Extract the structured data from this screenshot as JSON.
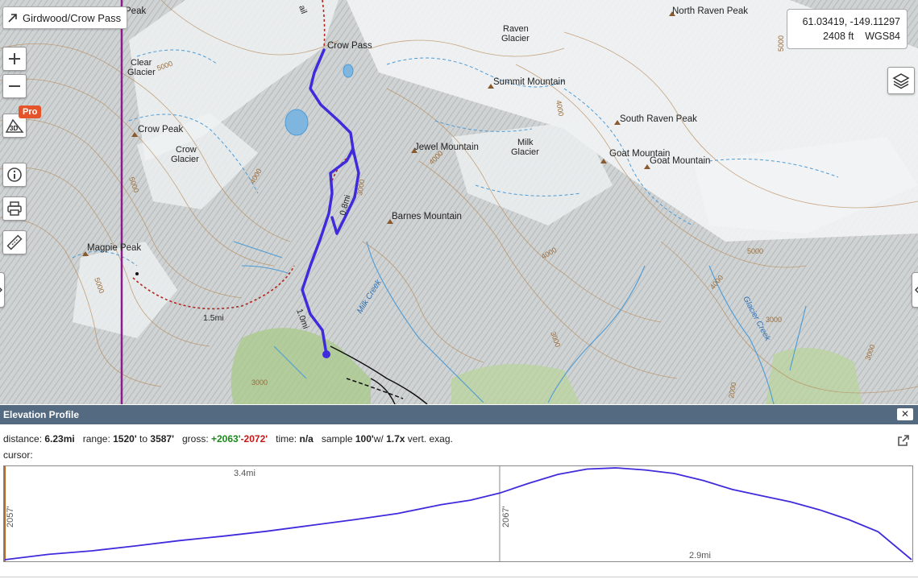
{
  "map": {
    "title": "Girdwood/Crow Pass",
    "coordinates": "61.03419, -149.11297",
    "elevation": "2408 ft",
    "datum": "WGS84",
    "pro_badge": "Pro",
    "btn_3d": "3D",
    "labels": {
      "peak_top": "Peak",
      "north_raven_peak": "North Raven Peak",
      "raven_glacier_1": "Raven",
      "raven_glacier_2": "Glacier",
      "crow_pass": "Crow Pass",
      "clear_glacier_1": "Clear",
      "clear_glacier_2": "Glacier",
      "summit_mountain": "Summit Mountain",
      "crow_peak": "Crow Peak",
      "crow_glacier_1": "Crow",
      "crow_glacier_2": "Glacier",
      "south_raven_peak": "South Raven Peak",
      "jewel_mountain": "Jewel Mountain",
      "milk_glacier_1": "Milk",
      "milk_glacier_2": "Glacier",
      "goat_mountain_1": "Goat Mountain",
      "goat_mountain_2": "Goat Mountain",
      "barnes_mountain": "Barnes Mountain",
      "magpie_peak": "Magpie Peak",
      "milk_creek": "Milk Creek",
      "glacier_creek": "Glacier Creek",
      "dist_1_5": "1.5mi",
      "dist_1_0": "1.0mi",
      "dist_0_8": "0.8mi",
      "trail_fragment": "ail"
    },
    "contours": [
      "5000",
      "5000",
      "4000",
      "3000",
      "5000",
      "4000",
      "4000",
      "5000",
      "4000",
      "3000",
      "4000",
      "3000",
      "2000",
      "3000",
      "3000",
      "5000"
    ],
    "colors": {
      "route": "#3f2bdc",
      "trail_red": "#b3261e",
      "boundary": "#8e1a8e",
      "water": "#4d9bd6"
    }
  },
  "elevation": {
    "header": "Elevation Profile",
    "close": "✕",
    "stats": {
      "distance_label": "distance:",
      "distance": "6.23mi",
      "range_label": "range:",
      "range_min": "1520'",
      "range_to": "to",
      "range_max": "3587'",
      "gross_label": "gross:",
      "gain": "+2063'",
      "loss": "-2072'",
      "time_label": "time:",
      "time": "n/a",
      "sample_label": "sample",
      "sample": "100'",
      "w_label": "w/",
      "exag": "1.7x",
      "exag_label": "vert. exag."
    },
    "cursor_label": "cursor:",
    "profile": {
      "left_gain": "2057'",
      "right_gain": "2067'",
      "left_distance": "3.4mi",
      "right_distance": "2.9mi",
      "min_ft": 1520,
      "max_ft": 3587,
      "total_mi": 6.23,
      "split_mi": 3.4,
      "points_mi": [
        0,
        0.3,
        0.6,
        0.9,
        1.2,
        1.5,
        1.8,
        2.1,
        2.4,
        2.7,
        3.0,
        3.2,
        3.4,
        3.6,
        3.8,
        4.0,
        4.2,
        4.4,
        4.6,
        4.8,
        5.0,
        5.2,
        5.4,
        5.6,
        5.8,
        6.0,
        6.23
      ],
      "points_ft": [
        1520,
        1640,
        1720,
        1830,
        1950,
        2050,
        2160,
        2290,
        2420,
        2560,
        2760,
        2860,
        3020,
        3240,
        3440,
        3560,
        3587,
        3540,
        3460,
        3300,
        3100,
        2960,
        2820,
        2640,
        2420,
        2150,
        1520
      ]
    }
  }
}
